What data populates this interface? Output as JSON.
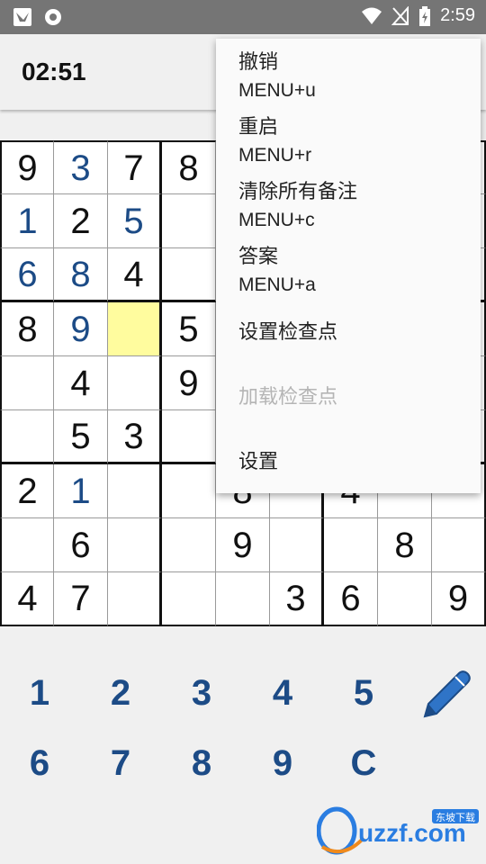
{
  "status_bar": {
    "time": "2:59",
    "left_icons": [
      "bird-notification-icon",
      "camera-notification-icon"
    ],
    "right_icons": [
      "wifi-icon",
      "no-signal-icon",
      "battery-charging-icon"
    ]
  },
  "app_bar": {
    "timer": "02:51"
  },
  "board": {
    "selected": [
      3,
      2
    ],
    "cells": [
      [
        {
          "v": "9",
          "t": "given"
        },
        {
          "v": "3",
          "t": "entered"
        },
        {
          "v": "7",
          "t": "given"
        },
        {
          "v": "8",
          "t": "given"
        },
        {
          "v": "",
          "t": ""
        },
        {
          "v": "",
          "t": ""
        },
        {
          "v": "",
          "t": ""
        },
        {
          "v": "",
          "t": ""
        },
        {
          "v": "",
          "t": ""
        }
      ],
      [
        {
          "v": "1",
          "t": "entered"
        },
        {
          "v": "2",
          "t": "given"
        },
        {
          "v": "5",
          "t": "entered"
        },
        {
          "v": "",
          "t": ""
        },
        {
          "v": "",
          "t": ""
        },
        {
          "v": "",
          "t": ""
        },
        {
          "v": "",
          "t": ""
        },
        {
          "v": "",
          "t": ""
        },
        {
          "v": "",
          "t": ""
        }
      ],
      [
        {
          "v": "6",
          "t": "entered"
        },
        {
          "v": "8",
          "t": "entered"
        },
        {
          "v": "4",
          "t": "given"
        },
        {
          "v": "",
          "t": ""
        },
        {
          "v": "",
          "t": ""
        },
        {
          "v": "",
          "t": ""
        },
        {
          "v": "",
          "t": ""
        },
        {
          "v": "",
          "t": ""
        },
        {
          "v": "",
          "t": ""
        }
      ],
      [
        {
          "v": "8",
          "t": "given"
        },
        {
          "v": "9",
          "t": "entered"
        },
        {
          "v": "",
          "t": ""
        },
        {
          "v": "5",
          "t": "given"
        },
        {
          "v": "",
          "t": ""
        },
        {
          "v": "",
          "t": ""
        },
        {
          "v": "",
          "t": ""
        },
        {
          "v": "",
          "t": ""
        },
        {
          "v": "",
          "t": ""
        }
      ],
      [
        {
          "v": "",
          "t": ""
        },
        {
          "v": "4",
          "t": "given"
        },
        {
          "v": "",
          "t": ""
        },
        {
          "v": "9",
          "t": "given"
        },
        {
          "v": "",
          "t": ""
        },
        {
          "v": "",
          "t": ""
        },
        {
          "v": "",
          "t": ""
        },
        {
          "v": "",
          "t": ""
        },
        {
          "v": "",
          "t": ""
        }
      ],
      [
        {
          "v": "",
          "t": ""
        },
        {
          "v": "5",
          "t": "given"
        },
        {
          "v": "3",
          "t": "given"
        },
        {
          "v": "",
          "t": ""
        },
        {
          "v": "",
          "t": ""
        },
        {
          "v": "",
          "t": ""
        },
        {
          "v": "",
          "t": ""
        },
        {
          "v": "",
          "t": ""
        },
        {
          "v": "",
          "t": ""
        }
      ],
      [
        {
          "v": "2",
          "t": "given"
        },
        {
          "v": "1",
          "t": "entered"
        },
        {
          "v": "",
          "t": ""
        },
        {
          "v": "",
          "t": ""
        },
        {
          "v": "8",
          "t": "given"
        },
        {
          "v": "",
          "t": ""
        },
        {
          "v": "4",
          "t": "given"
        },
        {
          "v": "",
          "t": ""
        },
        {
          "v": "",
          "t": ""
        }
      ],
      [
        {
          "v": "",
          "t": ""
        },
        {
          "v": "6",
          "t": "given"
        },
        {
          "v": "",
          "t": ""
        },
        {
          "v": "",
          "t": ""
        },
        {
          "v": "9",
          "t": "given"
        },
        {
          "v": "",
          "t": ""
        },
        {
          "v": "",
          "t": ""
        },
        {
          "v": "8",
          "t": "given"
        },
        {
          "v": "",
          "t": ""
        }
      ],
      [
        {
          "v": "4",
          "t": "given"
        },
        {
          "v": "7",
          "t": "given"
        },
        {
          "v": "",
          "t": ""
        },
        {
          "v": "",
          "t": ""
        },
        {
          "v": "",
          "t": ""
        },
        {
          "v": "3",
          "t": "given"
        },
        {
          "v": "6",
          "t": "given"
        },
        {
          "v": "",
          "t": ""
        },
        {
          "v": "9",
          "t": "given"
        }
      ]
    ]
  },
  "keypad": {
    "keys": [
      "1",
      "2",
      "3",
      "4",
      "5",
      "6",
      "7",
      "8",
      "9",
      "C"
    ],
    "pencil_icon": "pencil-icon",
    "color": "#1c4b86"
  },
  "menu": {
    "items": [
      {
        "title": "撤销",
        "shortcut": "MENU+u",
        "enabled": true
      },
      {
        "title": "重启",
        "shortcut": "MENU+r",
        "enabled": true
      },
      {
        "title": "清除所有备注",
        "shortcut": "MENU+c",
        "enabled": true
      },
      {
        "title": "答案",
        "shortcut": "MENU+a",
        "enabled": true
      },
      {
        "title": "设置检查点",
        "shortcut": "",
        "enabled": true
      },
      {
        "title": "加载检查点",
        "shortcut": "",
        "enabled": false
      },
      {
        "title": "设置",
        "shortcut": "",
        "enabled": true
      }
    ]
  },
  "watermark": {
    "text": "uzzf.com",
    "tagline": "东坡下载"
  },
  "colors": {
    "selected_cell": "#fffc9e",
    "entered_digit": "#1c4b86",
    "status_bar": "#757575"
  }
}
